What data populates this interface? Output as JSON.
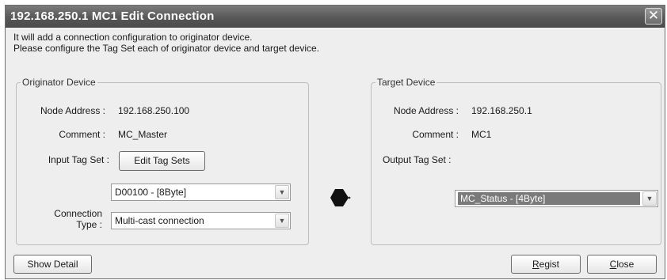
{
  "window": {
    "title": "192.168.250.1 MC1 Edit Connection",
    "close_glyph": "✕"
  },
  "intro": {
    "line1": "It will add a connection configuration to originator device.",
    "line2": "Please configure the Tag Set each of originator device and target device."
  },
  "originator": {
    "group_label": "Originator Device",
    "node_address_label": "Node Address :",
    "node_address_value": "192.168.250.100",
    "comment_label": "Comment :",
    "comment_value": "MC_Master",
    "input_tag_set_label": "Input Tag Set :",
    "edit_tag_sets_button": "Edit Tag Sets",
    "tag_set_selected": "D00100 - [8Byte]",
    "connection_type_label_1": "Connection",
    "connection_type_label_2": "Type :",
    "connection_type_selected": "Multi-cast connection"
  },
  "target": {
    "group_label": "Target Device",
    "node_address_label": "Node Address :",
    "node_address_value": "192.168.250.1",
    "comment_label": "Comment :",
    "comment_value": "MC1",
    "output_tag_set_label": "Output Tag Set :",
    "tag_set_selected": "MC_Status - [4Byte]"
  },
  "footer": {
    "show_detail_button": "Show Detail",
    "regist_mnemonic": "R",
    "regist_rest": "egist",
    "close_mnemonic": "C",
    "close_rest": "lose"
  },
  "icons": {
    "combo_arrow": "chevron-down-icon",
    "connector": "connection-arrow-icon"
  }
}
